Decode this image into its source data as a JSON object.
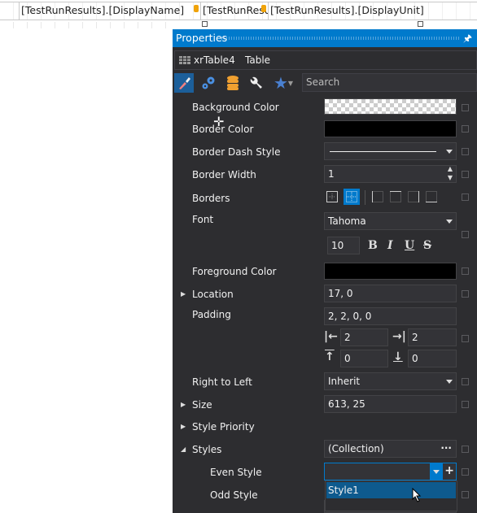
{
  "designer": {
    "cells": [
      "[TestRunResults].[DisplayName]",
      "[TestRunResults].[DisplayValue]",
      "[TestRunResults].[DisplayUnit]"
    ],
    "cell_visible": [
      "[TestRunResults].[DisplayName]",
      "[TestRunResult",
      "[TestRunResults].[DisplayUnit]"
    ]
  },
  "panel": {
    "title": "Properties",
    "pin_icon": "pin-icon",
    "object_name": "xrTable4",
    "object_type": "Table",
    "toolbar": [
      "brush-icon",
      "gears-icon",
      "database-icon",
      "wrench-icon",
      "star-icon"
    ],
    "search_placeholder": "Search",
    "accent": "#007acc"
  },
  "props": {
    "background_color": {
      "label": "Background Color",
      "value": "transparent"
    },
    "border_color": {
      "label": "Border Color",
      "value": "#000000"
    },
    "border_dash_style": {
      "label": "Border Dash Style",
      "value": "Solid"
    },
    "border_width": {
      "label": "Border Width",
      "value": "1"
    },
    "borders": {
      "label": "Borders"
    },
    "font": {
      "label": "Font",
      "value": "Tahoma",
      "size": "10",
      "styles": [
        "B",
        "I",
        "U",
        "S"
      ]
    },
    "foreground_color": {
      "label": "Foreground Color",
      "value": "#000000"
    },
    "location": {
      "label": "Location",
      "value": "17, 0"
    },
    "padding": {
      "label": "Padding",
      "value": "2, 2, 0, 0",
      "left": "2",
      "right": "2",
      "top": "0",
      "bottom": "0"
    },
    "right_to_left": {
      "label": "Right to Left",
      "value": "Inherit"
    },
    "size": {
      "label": "Size",
      "value": "613, 25"
    },
    "style_priority": {
      "label": "Style Priority"
    },
    "styles": {
      "label": "Styles",
      "value": "(Collection)",
      "ellipsis": "···"
    },
    "even_style": {
      "label": "Even Style",
      "value": "",
      "add": "+"
    },
    "odd_style": {
      "label": "Odd Style"
    },
    "dropdown_options": [
      "Style1"
    ]
  }
}
